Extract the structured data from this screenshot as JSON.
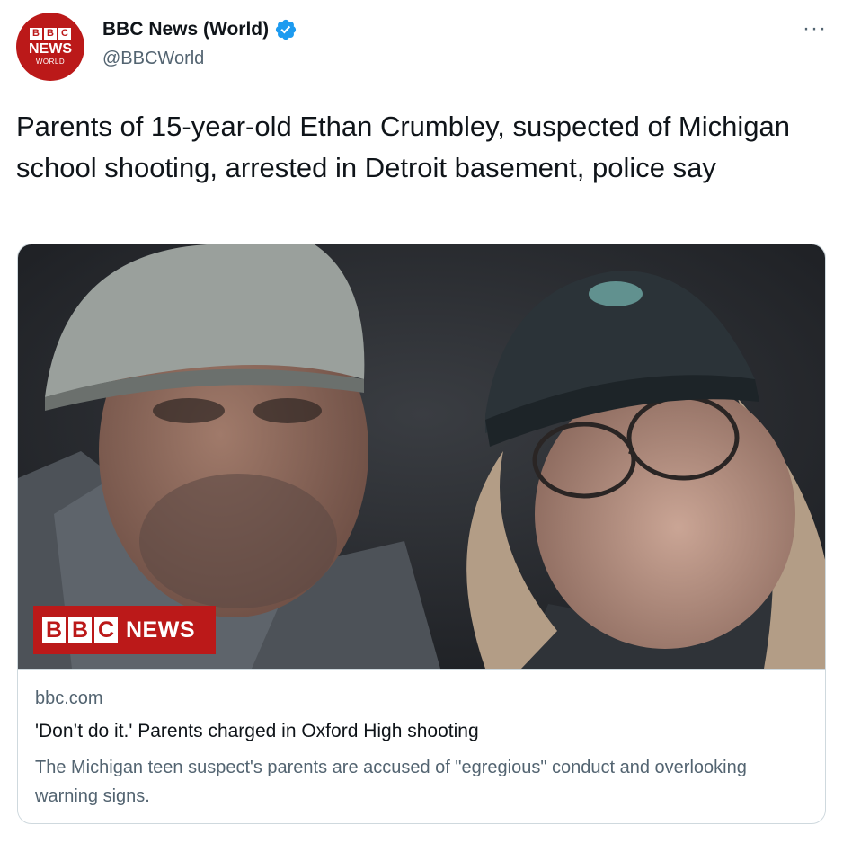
{
  "account": {
    "name": "BBC News (World)",
    "handle": "@BBCWorld",
    "avatar_letters": [
      "B",
      "B",
      "C"
    ],
    "avatar_news": "NEWS",
    "avatar_world": "WORLD",
    "verified_icon": "verified-badge-icon",
    "more_icon": "more-options-icon",
    "more_glyph": "···"
  },
  "tweet": {
    "text": "Parents of 15-year-old Ethan Crumbley, suspected of Michigan school shooting, arrested in Detroit basement, police say"
  },
  "card": {
    "image_logo_letters": [
      "B",
      "B",
      "C"
    ],
    "image_logo_news": "NEWS",
    "domain": "bbc.com",
    "title": "'Don’t do it.' Parents charged in Oxford High shooting",
    "description": "The Michigan teen suspect's parents are accused of \"egregious\" conduct and overlooking warning signs."
  },
  "colors": {
    "brand_red": "#bb1919",
    "verified_blue": "#1d9bf0",
    "text_primary": "#0f1419",
    "text_secondary": "#536471",
    "border": "#cfd9de"
  }
}
